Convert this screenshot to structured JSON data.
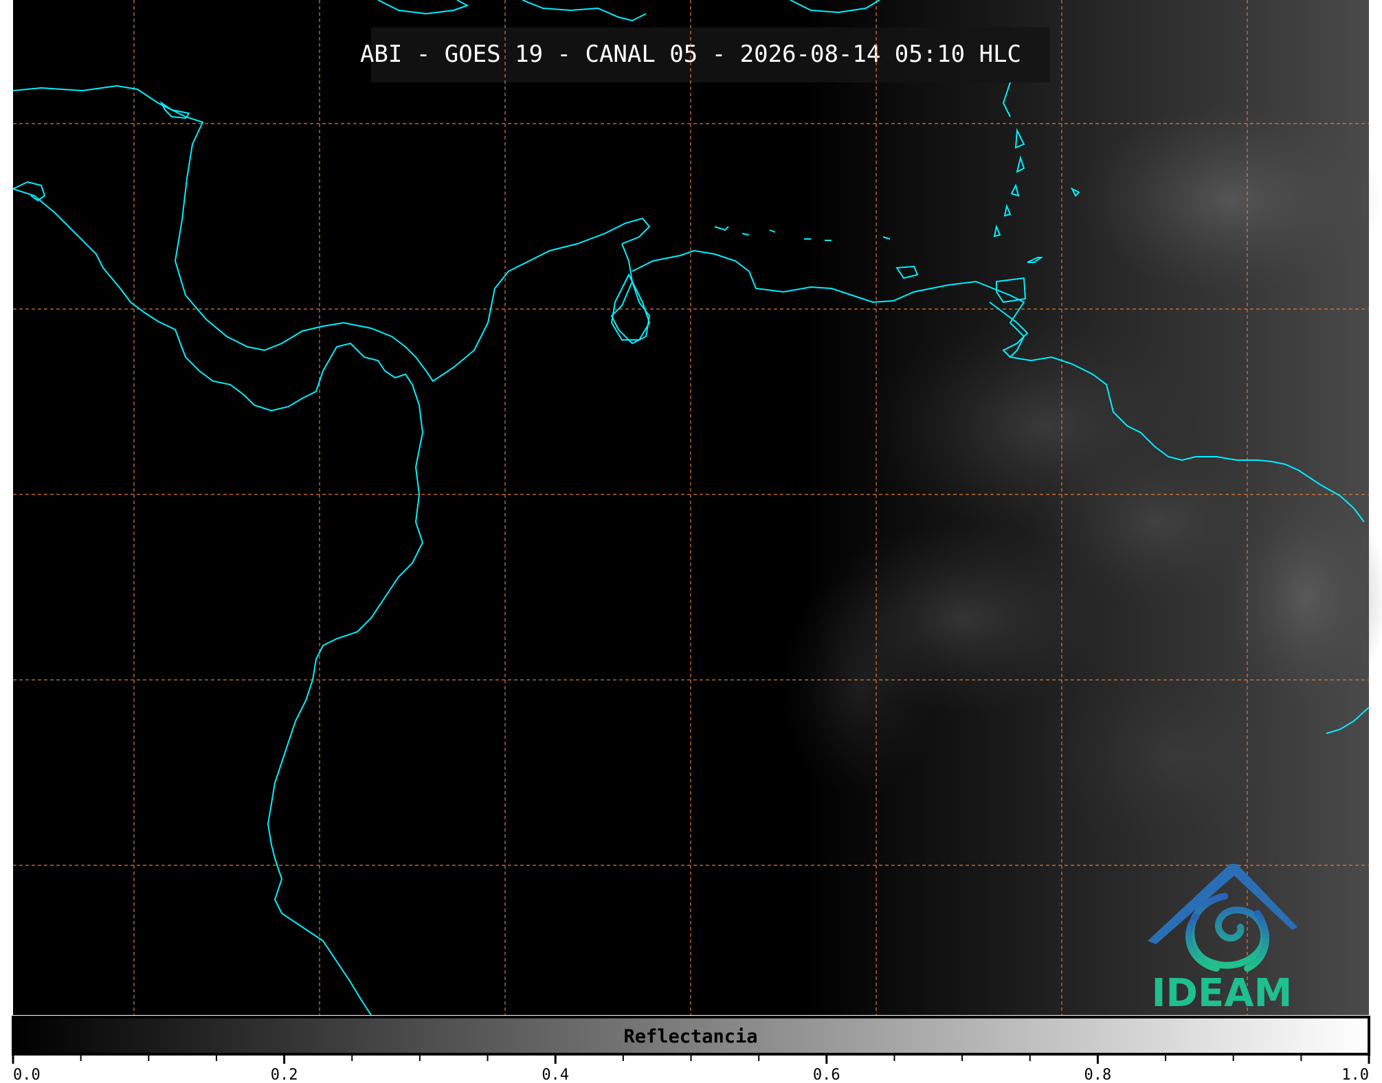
{
  "title": "ABI - GOES 19 - CANAL 05 - 2026-08-14 05:10 HLC",
  "colors": {
    "coastline": "#00f0ff",
    "graticule": "#e07a30",
    "background": "#000000",
    "logo_blue": "#2a6fb5",
    "logo_green": "#1fbf8f"
  },
  "map": {
    "graticule_style": "dashed",
    "graticule_columns": 7,
    "graticule_rows": 5
  },
  "colorbar": {
    "label": "Reflectancia",
    "range": [
      0.0,
      1.0
    ],
    "colormap": "black-to-white",
    "ticks": [
      {
        "value": 0.0,
        "label": "0.0"
      },
      {
        "value": 0.2,
        "label": "0.2"
      },
      {
        "value": 0.4,
        "label": "0.4"
      },
      {
        "value": 0.6,
        "label": "0.6"
      },
      {
        "value": 0.8,
        "label": "0.8"
      },
      {
        "value": 1.0,
        "label": "1.0"
      }
    ],
    "minor_tick_step": 0.05
  },
  "logo": {
    "text": "IDEAM"
  }
}
